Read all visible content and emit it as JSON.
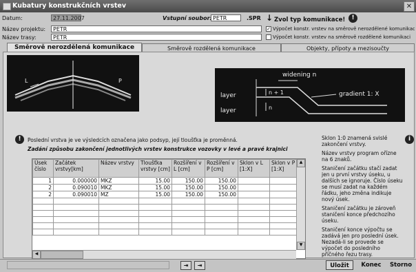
{
  "window": {
    "title": "Kubatury konstrukčních vrstev",
    "close": "✕"
  },
  "header": {
    "datum_label": "Datum:",
    "datum_value": "27.11.2007",
    "vstupni_label": "Vstupní soubor:",
    "vstupni_value": "PETR",
    "vstupni_ext": ".SPR",
    "projekt_label": "Název projektu:",
    "projekt_value": "PETR",
    "trasa_label": "Název trasy:",
    "trasa_value": "PETR",
    "zvol_label": "Zvol typ komunikace!",
    "option1": "Výpočet konstr. vrstev na směrově nerozdělené komunikaci",
    "option2": "Výpočet konstr. vrstev na směrově rozdělené komunikaci"
  },
  "tabs": [
    {
      "label": "Směrově nerozdělená komunikace"
    },
    {
      "label": "Směrově rozdělená komunikace"
    },
    {
      "label": "Objekty, přípoty a mezisoučty"
    }
  ],
  "diagram": {
    "left_letter": "L",
    "right_letter": "P",
    "layer1": "layer",
    "layer2": "layer",
    "widening": "widening n",
    "n_plus": "n + 1",
    "n": "n",
    "gradient": "gradient 1: X"
  },
  "notice": "Poslední vrstva je ve výsledcích označena jako podsyp, její tloušťka je proměnná.",
  "instruction": "Zadání způsobu zakončení jednotlivých vrstev konstrukce vozovky v levé a pravé krajnici",
  "table": {
    "headers": [
      "Úsek číslo",
      "Začátek vrstvy[km]",
      "Název vrstvy",
      "Tloušťka vrstvy [cm]",
      "Rozšíření v L [cm]",
      "Rozšíření v P [cm]",
      "Sklon v L [1:X]",
      "Sklon v P [1:X]"
    ],
    "rows": [
      [
        "1",
        "0.000000",
        "MKZ",
        "15.00",
        "150.00",
        "150.00",
        "",
        ""
      ],
      [
        "2",
        "0.090010",
        "MKZ",
        "15.00",
        "150.00",
        "150.00",
        "",
        ""
      ],
      [
        "2",
        "0.090010",
        "MZ",
        "15.00",
        "150.00",
        "150.00",
        "",
        ""
      ]
    ]
  },
  "side_notes": [
    "Sklon 1:0 znamená svislé zakončení vrstvy.",
    "Název vrstvy program ořízne na 6 znaků.",
    "Staničení začátku stačí zadat jen u první vrstvy úseku, u dalších se ignoruje. Číslo úseku se musí zadat na každém řádku, jeho změna indikuje nový úsek.",
    "Staničení začátku je zároveň staničení konce předchozího úseku.",
    "Staničení konce výpočtu se zadává jen pro poslední úsek. Nezadá-li se provede se výpočet do posledního příčného řezu trasy."
  ],
  "buttons": {
    "ulozit": "Uložit",
    "konec": "Konec",
    "storno": "Storno"
  }
}
